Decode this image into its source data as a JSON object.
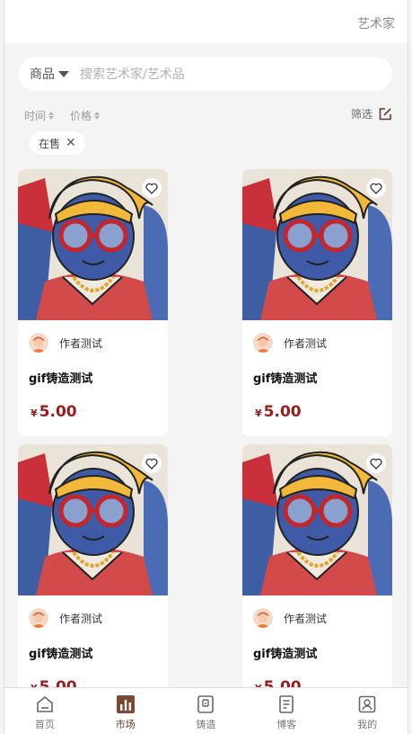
{
  "header": {
    "right_link": "艺术家"
  },
  "search": {
    "category": "商品",
    "placeholder": "搜索艺术家/艺术品"
  },
  "sort": {
    "time_label": "时间",
    "price_label": "价格",
    "filter_label": "筛选"
  },
  "active_filter": {
    "label": "在售"
  },
  "products": [
    {
      "author": "作者测试",
      "title": "gif铸造测试",
      "currency": "¥",
      "price": "5.00"
    },
    {
      "author": "作者测试",
      "title": "gif铸造测试",
      "currency": "¥",
      "price": "5.00"
    },
    {
      "author": "作者测试",
      "title": "gif铸造测试",
      "currency": "¥",
      "price": "5.00"
    },
    {
      "author": "作者测试",
      "title": "gif铸造测试",
      "currency": "¥",
      "price": "5.00"
    }
  ],
  "tabbar": {
    "items": [
      {
        "label": "首页",
        "icon": "home-icon"
      },
      {
        "label": "市场",
        "icon": "market-chart-icon",
        "active": true
      },
      {
        "label": "铸造",
        "icon": "mint-icon"
      },
      {
        "label": "博客",
        "icon": "blog-icon"
      },
      {
        "label": "我的",
        "icon": "profile-icon"
      }
    ]
  },
  "colors": {
    "accent": "#5a3a2a",
    "price": "#9b1c1c",
    "background": "#f4f4f4"
  }
}
